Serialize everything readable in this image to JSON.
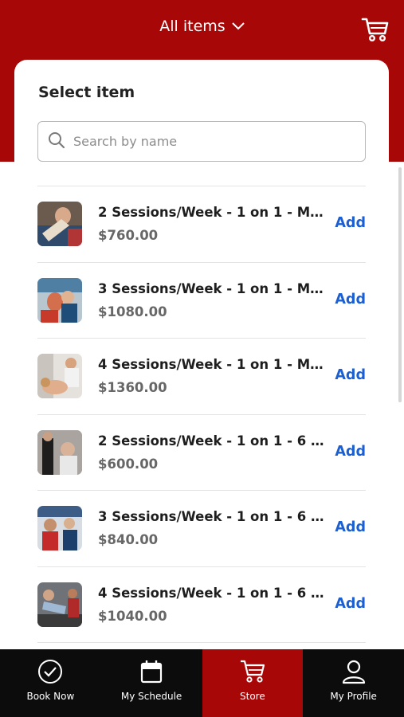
{
  "header": {
    "title": "All items",
    "chevron_icon": "chevron-down-icon",
    "cart_icon": "cart-icon",
    "background_color": "#a80707"
  },
  "card": {
    "title": "Select item"
  },
  "search": {
    "placeholder": "Search by name",
    "value": "",
    "icon": "search-icon"
  },
  "items": [
    {
      "name": "2 Sessions/Week - 1 on 1 - Mon...",
      "price": "$760.00",
      "action": "Add"
    },
    {
      "name": "3 Sessions/Week - 1 on 1 - Mon...",
      "price": "$1080.00",
      "action": "Add"
    },
    {
      "name": "4 Sessions/Week - 1 on 1 - Mon...",
      "price": "$1360.00",
      "action": "Add"
    },
    {
      "name": "2 Sessions/Week - 1 on 1 - 6 M...",
      "price": "$600.00",
      "action": "Add"
    },
    {
      "name": "3 Sessions/Week - 1 on 1 - 6 M...",
      "price": "$840.00",
      "action": "Add"
    },
    {
      "name": "4 Sessions/Week - 1 on 1 - 6 M...",
      "price": "$1040.00",
      "action": "Add"
    }
  ],
  "bottom_nav": [
    {
      "label": "Book Now",
      "icon": "check-circle-icon",
      "active": false
    },
    {
      "label": "My Schedule",
      "icon": "calendar-icon",
      "active": false
    },
    {
      "label": "Store",
      "icon": "cart-icon",
      "active": true
    },
    {
      "label": "My Profile",
      "icon": "user-icon",
      "active": false
    }
  ],
  "colors": {
    "brand_red": "#a80707",
    "link_blue": "#1b5fd1",
    "nav_dark": "#0c0c0c"
  }
}
